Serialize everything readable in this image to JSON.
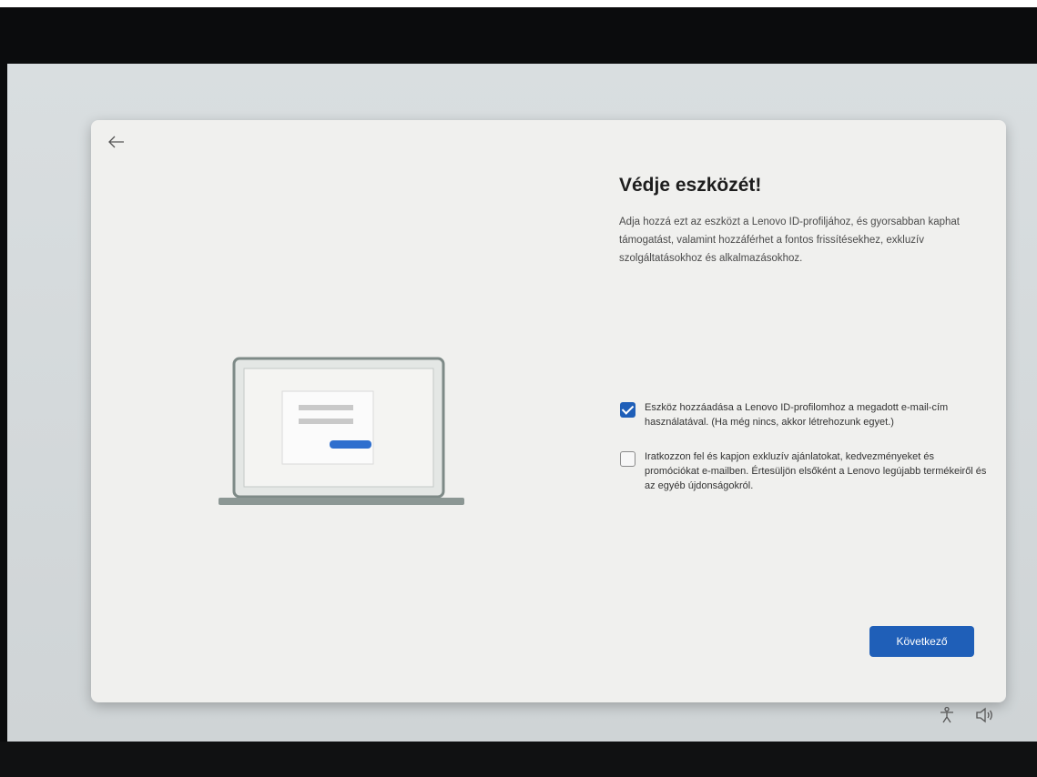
{
  "dialog": {
    "title": "Védje eszközét!",
    "description": "Adja hozzá ezt az eszközt a Lenovo ID-profiljához, és gyorsabban kaphat támogatást, valamint hozzáférhet a fontos frissítésekhez, exkluzív szolgáltatásokhoz és alkalmazásokhoz.",
    "checkbox_add_device": {
      "label": "Eszköz hozzáadása a Lenovo ID-profilomhoz a megadott e-mail-cím használatával. (Ha még nincs, akkor létrehozunk egyet.)",
      "checked": true
    },
    "checkbox_subscribe": {
      "label": "Iratkozzon fel és kapjon exkluzív ajánlatokat, kedvezményeket és promóciókat e-mailben. Értesüljön elsőként a Lenovo legújabb termékeiről és az egyéb újdonságokról.",
      "checked": false
    },
    "next_button": "Következő"
  },
  "icons": {
    "back": "back-arrow-icon",
    "accessibility": "accessibility-icon",
    "volume": "volume-icon"
  },
  "colors": {
    "accent": "#1f5fb8",
    "dialog_background": "#f0f0ee"
  }
}
